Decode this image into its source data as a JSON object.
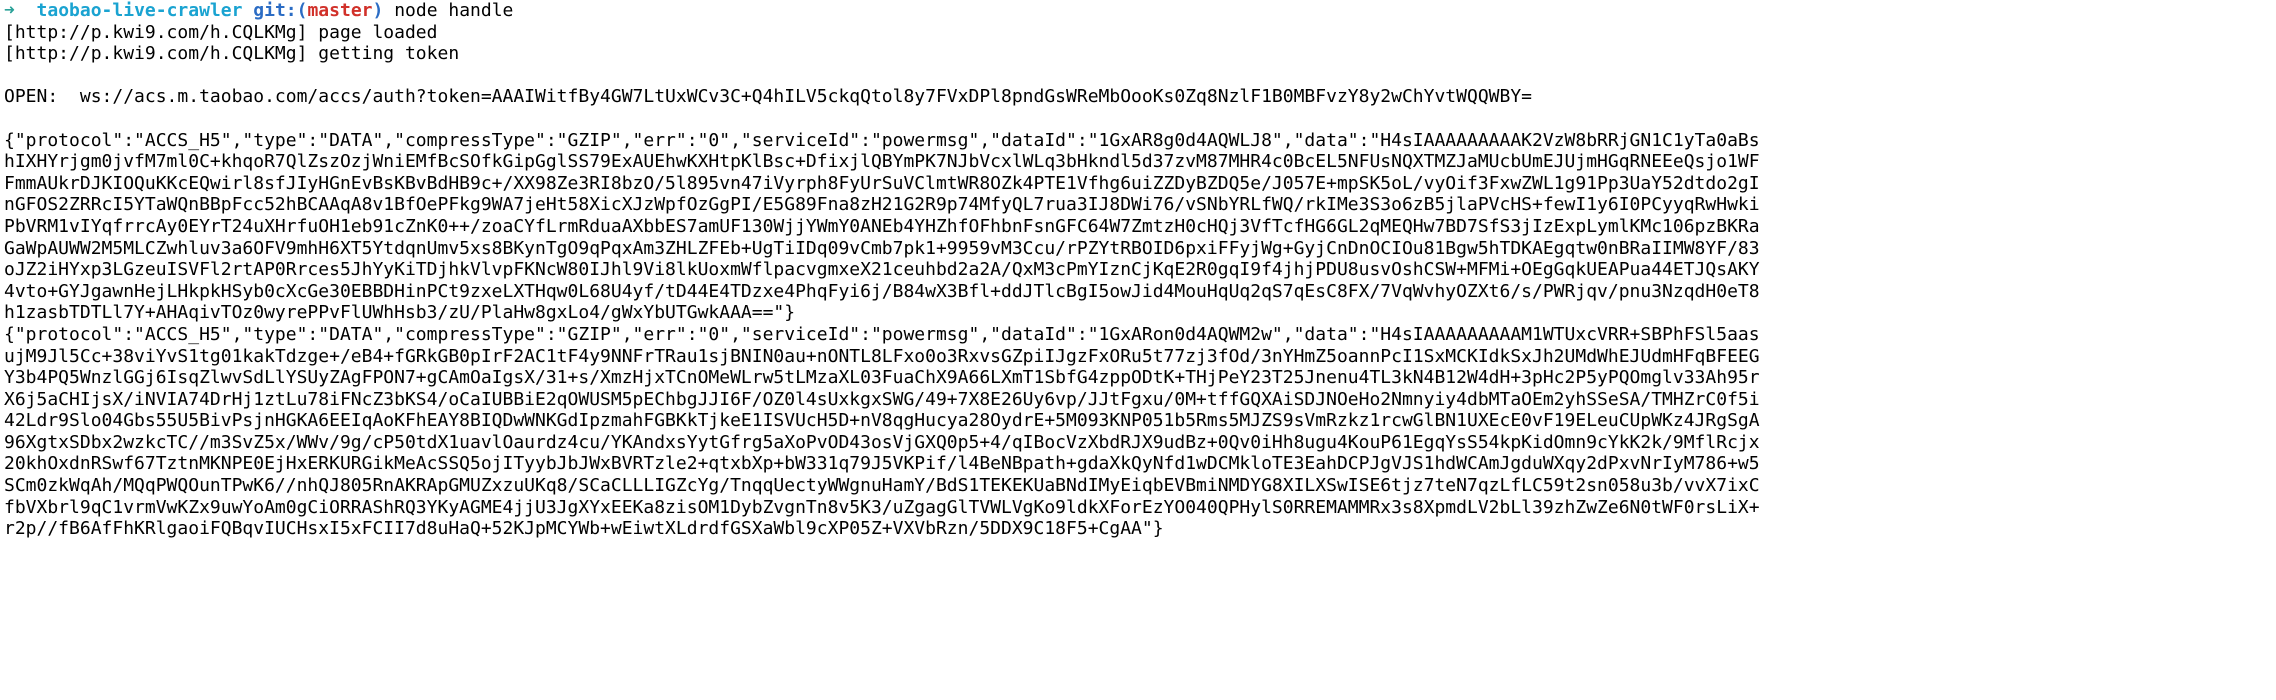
{
  "prompt": {
    "arrow": "➜",
    "directory": "taobao-live-crawler",
    "git_prefix": "git:(",
    "branch": "master",
    "git_suffix": ")",
    "command": "node handle"
  },
  "output": [
    "[http://p.kwi9.com/h.CQLKMg] page loaded",
    "[http://p.kwi9.com/h.CQLKMg] getting token",
    "",
    "OPEN:  ws://acs.m.taobao.com/accs/auth?token=AAAIWitfBy4GW7LtUxWCv3C+Q4hILV5ckqQtol8y7FVxDPl8pndGsWReMbOooKs0Zq8NzlF1B0MBFvzY8y2wChYvtWQQWBY=",
    "",
    "{\"protocol\":\"ACCS_H5\",\"type\":\"DATA\",\"compressType\":\"GZIP\",\"err\":\"0\",\"serviceId\":\"powermsg\",\"dataId\":\"1GxAR8g0d4AQWLJ8\",\"data\":\"H4sIAAAAAAAAAK2VzW8bRRjGN1C1yTa0aBs",
    "hIXHYrjgm0jvfM7ml0C+khqoR7QlZszOzjWniEMfBcSOfkGipGglSS79ExAUEhwKXHtpKlBsc+DfixjlQBYmPK7NJbVcxlWLq3bHkndl5d37zvM87MHR4c0BcEL5NFUsNQXTMZJaMUcbUmEJUjmHGqRNEEeQsjo1WF",
    "FmmAUkrDJKIOQuKKcEQwirl8sfJIyHGnEvBsKBvBdHB9c+/XX98Ze3RI8bzO/5l895vn47iVyrph8FyUrSuVClmtWR8OZk4PTE1Vfhg6uiZZDyBZDQ5e/J057E+mpSK5oL/vyOif3FxwZWL1g91Pp3UaY52dtdo2gI",
    "nGFOS2ZRRcI5YTaWQnBBpFcc52hBCAAqA8v1BfOePFkg9WA7jeHt58XicXJzWpfOzGgPI/E5G89Fna8zH21G2R9p74MfyQL7rua3IJ8DWi76/vSNbYRLfWQ/rkIMe3S3o6zB5jlaPVcHS+fewI1y6I0PCyyqRwHwki",
    "PbVRM1vIYqfrrcAy0EYrT24uXHrfuOH1eb91cZnK0++/zoaCYfLrmRduaAXbbES7amUF130WjjYWmY0ANEb4YHZhfOFhbnFsnGFC64W7ZmtzH0cHQj3VfTcfHG6GL2qMEQHw7BD7SfS3jIzExpLymlKMc106pzBKRa",
    "GaWpAUWW2M5MLCZwhluv3a6OFV9mhH6XT5YtdqnUmv5xs8BKynTgO9qPqxAm3ZHLZFEb+UgTiIDq09vCmb7pk1+9959vM3Ccu/rPZYtRBOID6pxiFFyjWg+GyjCnDnOCIOu81Bgw5hTDKAEgqtw0nBRaIIMW8YF/83",
    "oJZ2iHYxp3LGzeuISVFl2rtAP0Rrces5JhYyKiTDjhkVlvpFKNcW80IJhl9Vi8lkUoxmWflpacvgmxeX21ceuhbd2a2A/QxM3cPmYIznCjKqE2R0gqI9f4jhjPDU8usvOshCSW+MFMi+OEgGqkUEAPua44ETJQsAKY",
    "4vto+GYJgawnHejLHkpkHSyb0cXcGe30EBBDHinPCt9zxeLXTHqw0L68U4yf/tD44E4TDzxe4PhqFyi6j/B84wX3Bfl+ddJTlcBgI5owJid4MouHqUq2qS7qEsC8FX/7VqWvhyOZXt6/s/PWRjqv/pnu3NzqdH0eT8",
    "h1zasbTDTLl7Y+AHAqivTOz0wyrePPvFlUWhHsb3/zU/PlaHw8gxLo4/gWxYbUTGwkAAA==\"}",
    "{\"protocol\":\"ACCS_H5\",\"type\":\"DATA\",\"compressType\":\"GZIP\",\"err\":\"0\",\"serviceId\":\"powermsg\",\"dataId\":\"1GxARon0d4AQWM2w\",\"data\":\"H4sIAAAAAAAAAM1WTUxcVRR+SBPhFSl5aas",
    "ujM9Jl5Cc+38viYvS1tg01kakTdzge+/eB4+fGRkGB0pIrF2AC1tF4y9NNFrTRau1sjBNIN0au+nONTL8LFxo0o3RxvsGZpiIJgzFxORu5t77zj3fOd/3nYHmZ5oannPcI1SxMCKIdkSxJh2UMdWhEJUdmHFqBFEEG",
    "Y3b4PQ5WnzlGGj6IsqZlwvSdLlYSUyZAgFPON7+gCAmOaIgsX/31+s/XmzHjxTCnOMeWLrw5tLMzaXL03FuaChX9A66LXmT1SbfG4zppODtK+THjPeY23T25Jnenu4TL3kN4B12W4dH+3pHc2P5yPQOmglv33Ah95r",
    "X6j5aCHIjsX/iNVIA74DrHj1ztLu78iFNcZ3bKS4/oCaIUBBiE2qOWUSM5pEChbgJJI6F/OZ0l4sUxkgxSWG/49+7X8E26Uy6vp/JJtFgxu/0M+tffGQXAiSDJNOeHo2Nmnyiy4dbMTaOEm2yhSSeSA/TMHZrC0f5i",
    "42Ldr9Slo04Gbs55U5BivPsjnHGKA6EEIqAoKFhEAY8BIQDwWNKGdIpzmahFGBKkTjkeE1ISVUcH5D+nV8qgHucya28OydrE+5M093KNP051b5Rms5MJZS9sVmRzkz1rcwGlBN1UXEcE0vF19ELeuCUpWKz4JRgSgA",
    "96XgtxSDbx2wzkcTC//m3SvZ5x/WWv/9g/cP50tdX1uavlOaurdz4cu/YKAndxsYytGfrg5aXoPvOD43osVjGXQ0p5+4/qIBocVzXbdRJX9udBz+0Qv0iHh8ugu4KouP61EgqYsS54kpKidOmn9cYkK2k/9MflRcjx",
    "20khOxdnRSwf67TztnMKNPE0EjHxERKURGikMeAcSSQ5ojITyybJbJWxBVRTzle2+qtxbXp+bW331q79J5VKPif/l4BeNBpath+gdaXkQyNfd1wDCMkloTE3EahDCPJgVJS1hdWCAmJgduWXqy2dPxvNrIyM786+w5",
    "SCm0zkWqAh/MQqPWQOunTPwK6//nhQJ805RnAKRApGMUZxzuUKq8/SCaCLLLIGZcYg/TnqqUectyWWgnuHamY/BdS1TEKEKUaBNdIMyEiqbEVBmiNMDYG8XILXSwISE6tjz7teN7qzLfLC59t2sn058u3b/vvX7ixC",
    "fbVXbrl9qC1vrmVwKZx9uwYoAm0gCiORRAShRQ3YKyAGME4jjU3JgXYxEEKa8zisOM1DybZvgnTn8v5K3/uZgagGlTVWLVgKo9ldkXForEzYO040QPHylS0RREMAMMRx3s8XpmdLV2bLl39zhZwZe6N0tWF0rsLiX+",
    "r2p//fB6AfFhKRlgaoiFQBqvIUCHsxI5xFCII7d8uHaQ+52KJpMCYWb+wEiwtXLdrdfGSXaWbl9cXP05Z+VXVbRzn/5DDX9C18F5+CgAA\"}"
  ]
}
